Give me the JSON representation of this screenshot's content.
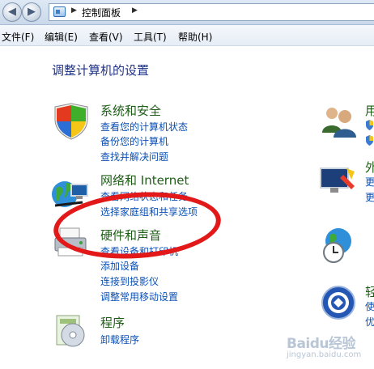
{
  "address_bar": {
    "crumb": "控制面板",
    "icons": [
      "back-arrow",
      "forward-arrow",
      "control-panel-icon",
      "breadcrumb-separator"
    ]
  },
  "menu": {
    "items": [
      "文件(F)",
      "编辑(E)",
      "查看(V)",
      "工具(T)",
      "帮助(H)"
    ]
  },
  "main": {
    "heading": "调整计算机的设置",
    "categories": [
      {
        "title": "系统和安全",
        "icon": "security-shield-icon",
        "links": [
          "查看您的计算机状态",
          "备份您的计算机",
          "查找并解决问题"
        ]
      },
      {
        "title": "网络和 Internet",
        "icon": "network-globe-icon",
        "links": [
          "查看网络状态和任务",
          "选择家庭组和共享选项"
        ]
      },
      {
        "title": "硬件和声音",
        "icon": "printer-icon",
        "links": [
          "查看设备和打印机",
          "添加设备",
          "连接到投影仪",
          "调整常用移动设置"
        ]
      },
      {
        "title": "程序",
        "icon": "programs-disc-icon",
        "links": [
          "卸载程序"
        ]
      }
    ],
    "right_column": {
      "partial_texts": [
        "用",
        "外",
        "更",
        "更",
        "轻",
        "使",
        "优"
      ]
    }
  },
  "annotation": {
    "color": "#e31818"
  },
  "watermark": {
    "text": "Baidu经验",
    "sub": "jingyan.baidu.com"
  }
}
